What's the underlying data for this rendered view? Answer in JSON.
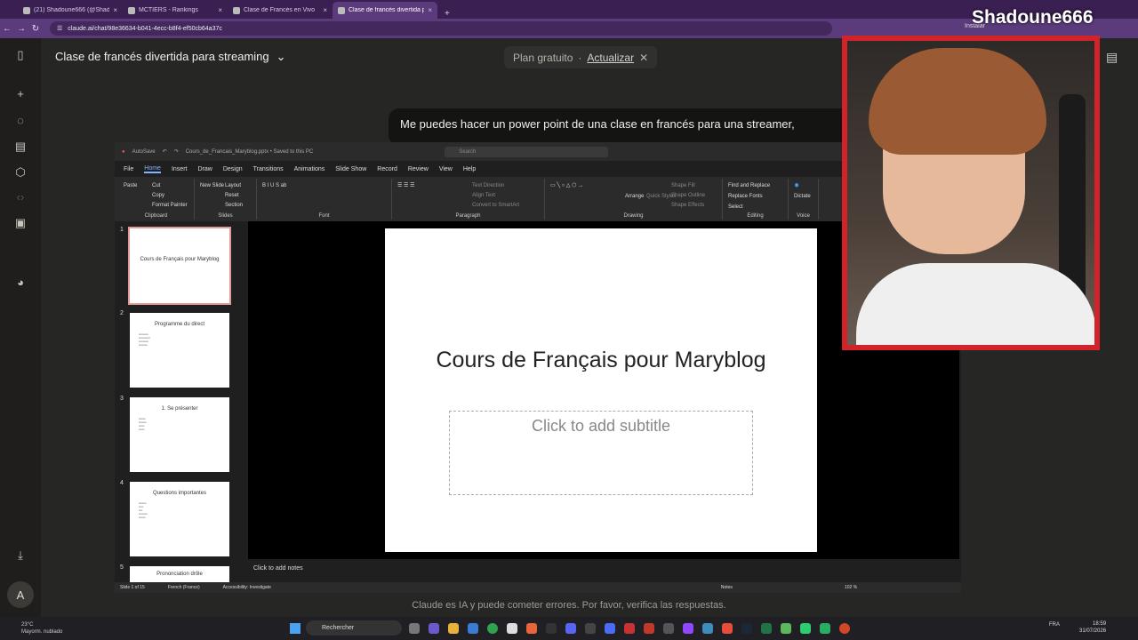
{
  "browser": {
    "tabs": [
      {
        "title": "(21) Shadoune666 (@Shadoun..."
      },
      {
        "title": "MCTIERS - Rankings"
      },
      {
        "title": "Clase de Francés en Vivo"
      },
      {
        "title": "Clase de francés divertida para..."
      }
    ],
    "url": "claude.ai/chat/98e36634-b041-4ecc-b8f4-ef50cb64a37c",
    "install_label": "Instalar"
  },
  "chat": {
    "title": "Clase de francés divertida para streaming",
    "plan_label": "Plan gratuito",
    "plan_separator": "·",
    "upgrade_label": "Actualizar",
    "user_message": "Me puedes hacer un power point de una clase en francés para una streamer,",
    "footer": "Claude es IA y puede cometer errores. Por favor, verifica las respuestas.",
    "avatar_initial": "A"
  },
  "ppt": {
    "autosave": "AutoSave",
    "filename": "Cours_de_Francais_Maryblog.pptx • Saved to this PC",
    "search_placeholder": "Search",
    "menu": [
      "File",
      "Home",
      "Insert",
      "Draw",
      "Design",
      "Transitions",
      "Animations",
      "Slide Show",
      "Record",
      "Review",
      "View",
      "Help"
    ],
    "active_menu": "Home",
    "ribbon": {
      "paste": "Paste",
      "cut": "Cut",
      "copy": "Copy",
      "format_painter": "Format Painter",
      "clipboard": "Clipboard",
      "new_slide": "New Slide",
      "layout": "Layout",
      "reset": "Reset",
      "section": "Section",
      "slides": "Slides",
      "font": "Font",
      "text_direction": "Text Direction",
      "align_text": "Align Text",
      "convert_smartart": "Convert to SmartArt",
      "paragraph": "Paragraph",
      "arrange": "Arrange",
      "quick_styles": "Quick Styles",
      "shape_fill": "Shape Fill",
      "shape_outline": "Shape Outline",
      "shape_effects": "Shape Effects",
      "drawing": "Drawing",
      "find_replace": "Find and Replace",
      "replace_fonts": "Replace Fonts",
      "select": "Select",
      "editing": "Editing",
      "dictate": "Dictate",
      "voice": "Voice"
    },
    "slides": [
      {
        "num": "1",
        "title": "Cours de Français pour Maryblog"
      },
      {
        "num": "2",
        "title": "Programme du direct"
      },
      {
        "num": "3",
        "title": "1. Se présenter"
      },
      {
        "num": "4",
        "title": "Questions importantes"
      },
      {
        "num": "5",
        "title": "Prononciation drôle"
      }
    ],
    "main_slide_title": "Cours de Français pour Maryblog",
    "subtitle_placeholder": "Click to add subtitle",
    "notes_placeholder": "Click to add notes",
    "status": {
      "slide_count": "Slide 1 of 15",
      "language": "French (France)",
      "accessibility": "Accessibility: Investigate",
      "notes": "Notes",
      "zoom": "102 %"
    }
  },
  "stream": {
    "name": "Shadoune666"
  },
  "taskbar": {
    "temperature": "23°C",
    "weather": "Mayorm. nublado",
    "search": "Rechercher",
    "lang": "FRA",
    "time": "18:59",
    "date": "31/07/2026"
  }
}
